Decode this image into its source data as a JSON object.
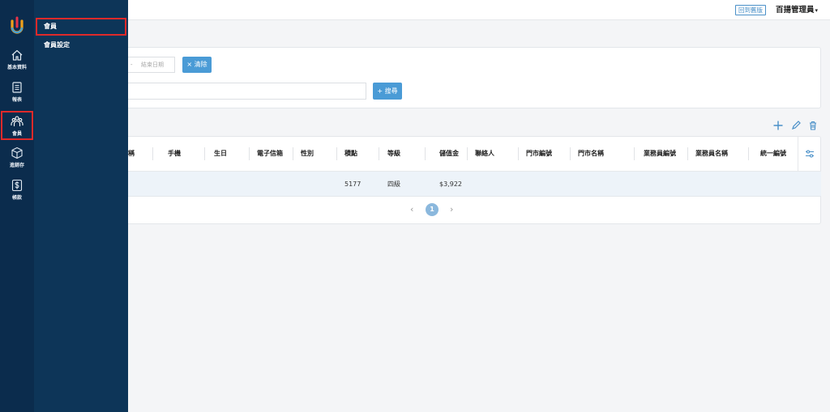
{
  "topbar": {
    "old_version_label": "回到舊版",
    "admin_name": "百揚管理員",
    "admin_caret": "▾"
  },
  "rail": {
    "items": [
      {
        "label": "基本資料",
        "icon": "home-icon"
      },
      {
        "label": "報表",
        "icon": "report-icon"
      },
      {
        "label": "會員",
        "icon": "members-icon"
      },
      {
        "label": "進銷存",
        "icon": "inventory-box-icon"
      },
      {
        "label": "帳款",
        "icon": "dollar-icon"
      }
    ]
  },
  "submenu": {
    "items": [
      {
        "label": "會員"
      },
      {
        "label": "會員設定"
      }
    ]
  },
  "filter": {
    "date_dash": "-",
    "end_date_placeholder": "結束日期",
    "clear_label": "× 清除",
    "search_label": "+ 搜尋"
  },
  "table": {
    "columns": [
      "稱",
      "手機",
      "生日",
      "電子信箱",
      "性別",
      "積點",
      "等級",
      "儲值金",
      "聯絡人",
      "門市編號",
      "門市名稱",
      "業務員編號",
      "業務員名稱",
      "統一編號"
    ],
    "rows": [
      {
        "points": "5177",
        "level": "四級",
        "stored_value": "$3,922"
      }
    ]
  },
  "pagination": {
    "prev": "‹",
    "current_page": "1",
    "next": "›"
  },
  "colors": {
    "rail_bg": "#0b2c4d",
    "submenu_bg": "#0d3558",
    "accent_blue": "#4a9bd6",
    "highlight_red": "#e02a2a"
  }
}
